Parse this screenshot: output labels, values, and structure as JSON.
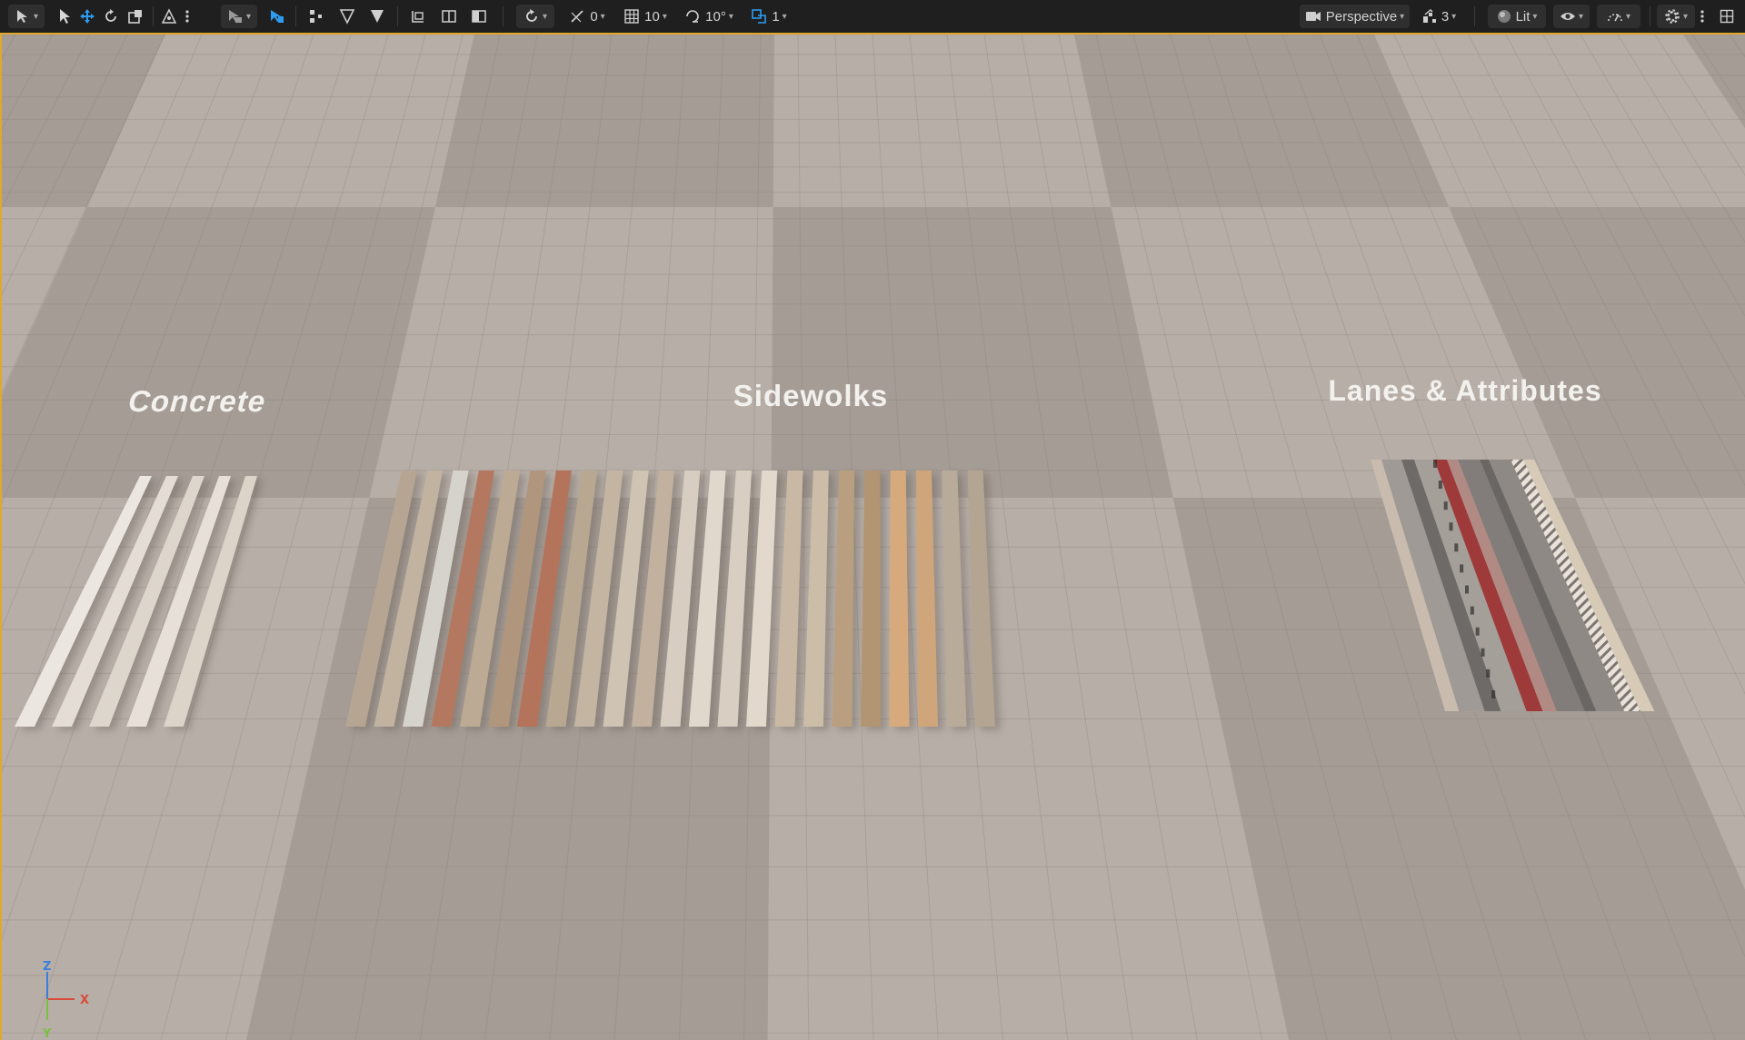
{
  "toolbar": {
    "translate_snap_value": "0",
    "grid_snap_value": "10",
    "rotation_snap_value": "10°",
    "camera_speed_value": "1",
    "view_mode_label": "Perspective",
    "scalability_value": "3",
    "lighting_mode_label": "Lit",
    "accent_color": "#2d9cf0"
  },
  "scene": {
    "group_labels": {
      "concrete": "Concrete",
      "sidewalks": "Sidewolks",
      "lanes": "Lanes & Attributes"
    }
  },
  "gizmo": {
    "z_label": "Z",
    "x_label": "X",
    "y_label": "Y",
    "colors": {
      "x": "#d94a3a",
      "y": "#7bc043",
      "z": "#3a7fe0"
    }
  },
  "icons": [
    "select-mode-icon",
    "select-arrow-icon",
    "move-icon",
    "rotate-icon",
    "scale-icon",
    "transform-origin-icon",
    "more-options-icon",
    "select-tool-icon",
    "actor-snap-icon",
    "vertex-icon",
    "triangle-outline-icon",
    "triangle-filled-icon",
    "surface-snap-icon",
    "split-view-icon",
    "half-fill-icon",
    "realtime-icon",
    "angle-snap-icon",
    "grid-icon",
    "rotation-snap-icon",
    "camera-speed-icon",
    "camera-icon",
    "scalability-icon",
    "lit-sphere-icon",
    "eye-icon",
    "performance-icon",
    "settings-gear-icon",
    "kebab-menu-icon",
    "layout-icon"
  ]
}
